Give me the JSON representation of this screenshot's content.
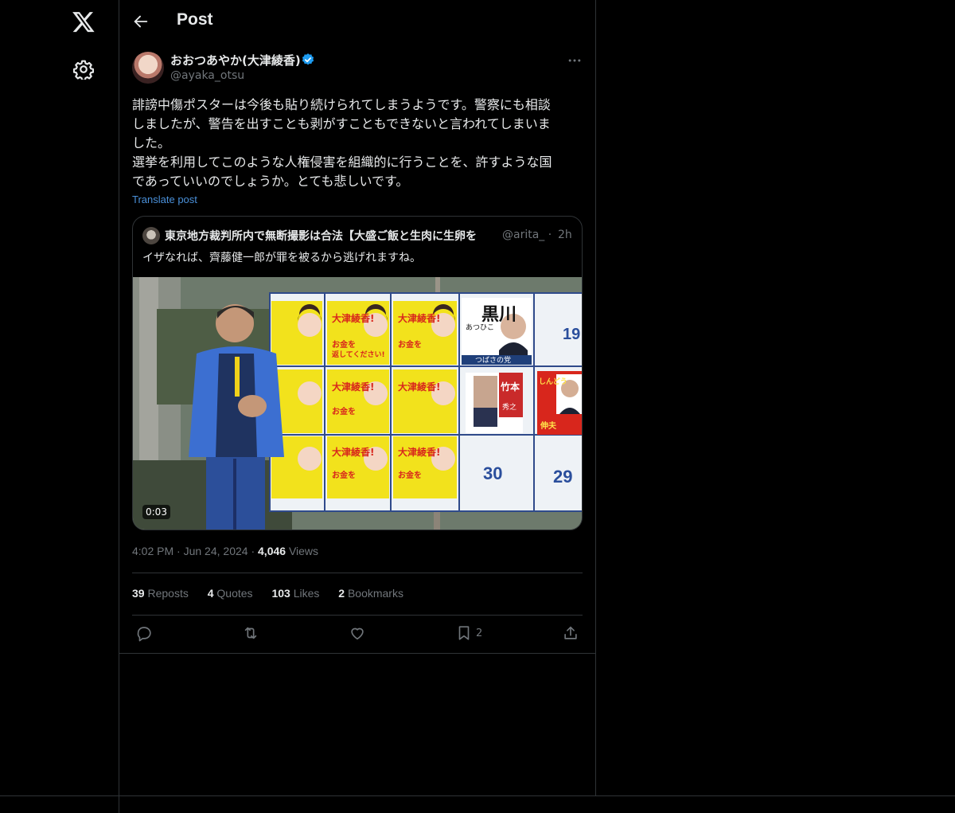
{
  "header": {
    "title": "Post"
  },
  "post": {
    "author_name": "おおつあやか(大津綾香)",
    "handle": "@ayaka_otsu",
    "text_lines": [
      "誹謗中傷ポスターは今後も貼り続けられてしまうようです。警察にも相談",
      "しましたが、警告を出すことも剥がすこともできないと言われてしまいま",
      "した。",
      "選挙を利用してこのような人権侵害を組織的に行うことを、許すような国",
      "であっていいのでしょうか。とても悲しいです。"
    ],
    "translate_label": "Translate post",
    "time": "4:02 PM",
    "date": "Jun 24, 2024",
    "views_count": "4,046",
    "views_label": "Views"
  },
  "quote": {
    "author_name": "東京地方裁判所内で無断撮影は合法【大盛ご飯と生肉に生卵を",
    "handle": "@arita_",
    "time": "2h",
    "text": "イザなれば、齊藤健一郎が罪を被るから逃げれますね。",
    "video_duration": "0:03",
    "poster_texts": {
      "name": "大津綾香!",
      "line1": "お金を",
      "line2": "返してください!",
      "kurokawa": "黒川",
      "atsuhiko": "あつひこ",
      "party": "つばさの党",
      "takemoto": "竹本",
      "hideyuki": "秀之",
      "shindo": "しんどう",
      "nobuo": "伸夫",
      "num19": "19",
      "num30": "30",
      "num29": "29"
    }
  },
  "stats": {
    "reposts_count": "39",
    "reposts_label": "Reposts",
    "quotes_count": "4",
    "quotes_label": "Quotes",
    "likes_count": "103",
    "likes_label": "Likes",
    "bookmarks_count": "2",
    "bookmarks_label": "Bookmarks"
  },
  "actions": {
    "bookmark_count": "2"
  },
  "colors": {
    "background": "#000000",
    "accent": "#1d9bf0",
    "muted": "#71767b",
    "border": "#2f3336",
    "poster_yellow": "#f2e21c",
    "poster_red": "#d8261c"
  },
  "icons": [
    "x-logo-icon",
    "gear-icon",
    "back-arrow-icon",
    "verified-badge-icon",
    "more-icon",
    "reply-icon",
    "repost-icon",
    "like-icon",
    "bookmark-icon",
    "share-icon"
  ]
}
